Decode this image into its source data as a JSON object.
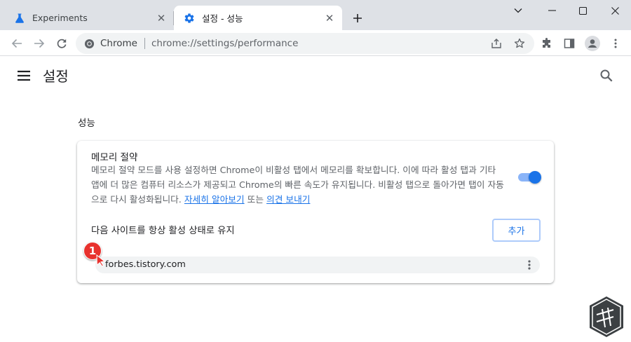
{
  "tabs": [
    {
      "title": "Experiments",
      "icon": "flask-icon",
      "active": false
    },
    {
      "title": "설정 - 성능",
      "icon": "gear-icon",
      "active": true
    }
  ],
  "toolbar": {
    "omnibox_chip": "Chrome",
    "omnibox_url": "chrome://settings/performance"
  },
  "settings": {
    "title": "설정"
  },
  "section": {
    "title": "성능"
  },
  "memory_saver": {
    "title": "메모리 절약",
    "desc_text": "메모리 절약 모드를 사용 설정하면 Chrome이 비활성 탭에서 메모리를 확보합니다. 이에 따라 활성 탭과 기타 앱에 더 많은 컴퓨터 리소스가 제공되고 Chrome의 빠른 속도가 유지됩니다. 비활성 탭으로 돌아가면 탭이 자동으로 다시 활성화됩니다. ",
    "learn_more_link": "자세히 알아보기",
    "conjunction": " 또는 ",
    "feedback_link": "의견 보내기",
    "enabled": true
  },
  "keep_active": {
    "label": "다음 사이트를 항상 활성 상태로 유지",
    "add_button": "추가",
    "sites": [
      "forbes.tistory.com"
    ]
  },
  "annotation": {
    "number": "1"
  },
  "colors": {
    "accent": "#1a73e8",
    "tabstrip": "#dee1e6",
    "marker": "#e8322e"
  }
}
